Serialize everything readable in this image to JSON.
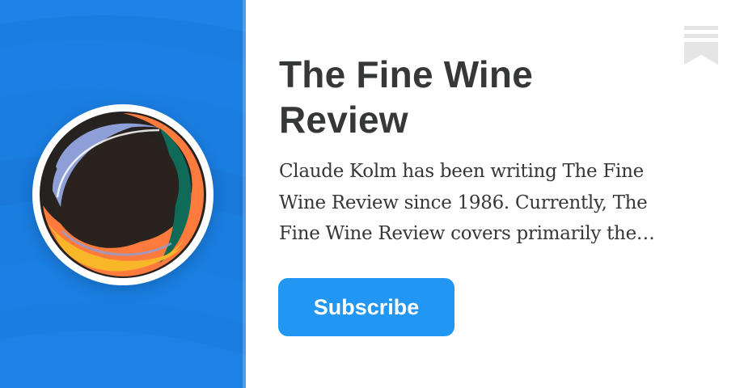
{
  "publication": {
    "title": "The Fine Wine Review",
    "description": "Claude Kolm has been writing The Fine Wine Review since 1986. Currently, The Fine Wine Review covers primarily the wines of Burgundy, the Rhône, Tuscany, Piedmont and California.",
    "logo_icon": "wine-glass-top-down-logo-icon"
  },
  "actions": {
    "subscribe_label": "Subscribe"
  },
  "icons": {
    "bookmark": "substack-bookmark-icon"
  },
  "colors": {
    "hero_background": "#1a7de0",
    "button_background": "#2196f3",
    "text": "#363737",
    "bookmark": "#e5e5e5"
  }
}
